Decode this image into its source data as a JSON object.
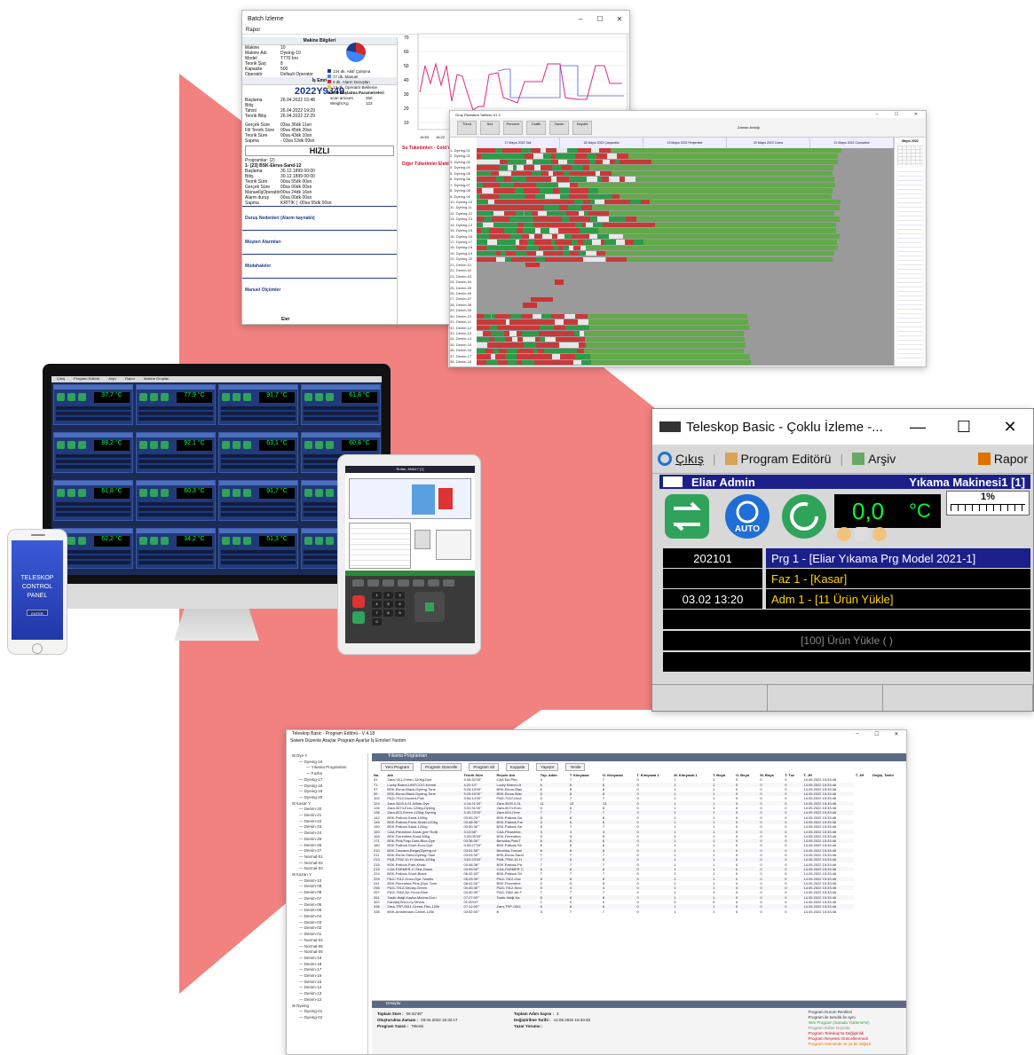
{
  "colors": {
    "accent_salmon": "#f2827f",
    "dark_navy": "#1b1f8a",
    "lcd_green": "#00ff33",
    "lcd_yellow": "#ffd400"
  },
  "batch_window": {
    "title": "Batch İzleme",
    "menu": "Rapor",
    "machine_header": "Makine Bilgileri",
    "machine_info": [
      {
        "k": "Makine",
        "v": "10"
      },
      {
        "k": "Makine Adı",
        "v": "Dyeing-10"
      },
      {
        "k": "Model",
        "v": "T770 bro"
      },
      {
        "k": "Teorik Şarj",
        "v": "8"
      },
      {
        "k": "Kapasite",
        "v": "500"
      },
      {
        "k": "Operatör",
        "v": "Default Operator"
      }
    ],
    "job_header": "İş Emri",
    "job_number": "2022Y9349",
    "job_info": [
      {
        "k": "Başlama",
        "v": "26.04.2022 15:48"
      },
      {
        "k": "Bitiş",
        "v": ""
      },
      {
        "k": "Tahsil",
        "v": "26.04.2022 19:29"
      },
      {
        "k": "Teorik Bitiş",
        "v": "26.04.2022 22:29"
      }
    ],
    "durations": [
      {
        "k": "Gerçek Süre",
        "v": "03sa 36dk 11sn"
      },
      {
        "k": "Fill Teorik Süre",
        "v": "00sa 45dk 20sn"
      },
      {
        "k": "Teorik Süre",
        "v": "00sa 43dk 10sn"
      },
      {
        "k": "Sapma",
        "v": "- 03sa 53dk 09sn"
      }
    ],
    "mode": "HIZLI",
    "programs_label": "Programlar: (2)",
    "program_name": "1- [23] BSK-Ekrus-Sand-12",
    "program_rows": [
      {
        "k": "Başlama",
        "v": "30.12.1899 00:00"
      },
      {
        "k": "Bitiş",
        "v": "30.12.1899 00:00"
      },
      {
        "k": "Teorik Süre",
        "v": "00sa 55dk 00sn"
      },
      {
        "k": "Gerçek Süre",
        "v": "00sa 00dk 00sn"
      },
      {
        "k": "ManuelİşOperatör",
        "v": "00sa 24dk 16sn"
      },
      {
        "k": "Alarm duruş",
        "v": "00sa 00dk 00sn"
      },
      {
        "k": "Sapma",
        "v": "KRİTİK ( -00sa 55dk 00sn"
      }
    ],
    "sections": [
      "Duruş Nedenleri (Alarm kaynaklı)",
      "Müşteri Alarmları",
      "Müdahaleler",
      "Manuel Olçümler"
    ],
    "legend": [
      "134 dk. Aktif Çalışma",
      "77 dk. Manuel",
      "0 dk. Alarm Duruşları",
      "13 dk. Operatör Bekleme"
    ],
    "param_header": "Batch Başlatma Parametreleri",
    "params": [
      {
        "k": "scan amount",
        "v": "260"
      },
      {
        "k": "Weight Kg",
        "v": "123"
      }
    ],
    "chart_ticks": [
      "70",
      "60",
      "50",
      "40",
      "30",
      "20",
      "10"
    ],
    "chart_time_ticks": [
      "15:53",
      "16:22",
      "16"
    ],
    "tab_labels": [
      "Su Tüketimleri - Cold W",
      "Diğer Tüketimler  Elektrik"
    ],
    "footer": "Eler"
  },
  "gantt_window": {
    "title": "Grup Planlama Tablosu V1.2",
    "tools": [
      "Tümü",
      "Seç",
      "Pencere",
      "Grafik",
      "Yazdır",
      "Kaydet"
    ],
    "period_label": "Zaman Aralığı",
    "date_headers": [
      "17 Mayıs 2022 Salı",
      "18 Mayıs 2022 Çarşamba",
      "19 Mayıs 2022 Perşembe",
      "20 Mayıs 2022 Cuma",
      "21 Mayıs 2022 Cumartesi"
    ],
    "calendar_title": "Mayıs 2022",
    "row_labels": [
      "1- Dyeing-01",
      "2- Dyeing-02",
      "3- Dyeing-03",
      "4- Dyeing-04",
      "5- Dyeing-05",
      "6- Dyeing-06",
      "7- Dyeing-07",
      "8- Dyeing-08",
      "9- Dyeing-09",
      "10- Dyeing-10",
      "11- Dyeing-11",
      "12- Dyeing-12",
      "13- Dyeing-13",
      "14- Dyeing-14",
      "15- Dyeing-15",
      "16- Dyeing-16",
      "17- Dyeing-17",
      "18- Dyeing-18",
      "19- Dyeing-19",
      "20- Dyeing-20",
      "21- Denim-01",
      "22- Denim-02",
      "23- Denim-03",
      "24- Denim-04",
      "25- Denim-05",
      "26- Denim-06",
      "27- Denim-07",
      "28- Denim-08",
      "29- Denim-09",
      "30- Denim-10",
      "31- Denim-11",
      "32- Denim-12",
      "33- Denim-13",
      "34- Denim-14",
      "35- Denim-15",
      "36- Denim-16",
      "37- Denim-17",
      "38- Denim-18"
    ]
  },
  "phone": {
    "line1": "TELESKOP",
    "line2": "CONTROL",
    "line3": "PANEL",
    "button": "ENTER"
  },
  "monitor": {
    "menu": [
      "Çıkış",
      "Program Editörü",
      "Arşiv",
      "Rapor",
      "Makine Grupları"
    ],
    "tiles": [
      {
        "value": "37,7 °C"
      },
      {
        "value": "77,9 °C"
      },
      {
        "value": "91,7 °C"
      },
      {
        "value": "61,8 °C"
      },
      {
        "value": "89,2 °C"
      },
      {
        "value": "92,1 °C"
      },
      {
        "value": "63,1 °C"
      },
      {
        "value": "60,8 °C"
      },
      {
        "value": "61,8 °C"
      },
      {
        "value": "60,3 °C"
      },
      {
        "value": "91,7 °C"
      },
      {
        "value": "81,1 °C"
      },
      {
        "value": "62,2 °C"
      },
      {
        "value": "34,2 °C"
      },
      {
        "value": "51,3 °C"
      },
      {
        "value": "79,8 °C"
      }
    ]
  },
  "tablet": {
    "title": "Rofan, ANA17 [1]",
    "keypad": [
      "1",
      "2",
      "3",
      "4",
      "5",
      "6",
      "7",
      "8",
      "9",
      "0"
    ]
  },
  "teleskop": {
    "title": "Teleskop Basic - Çoklu İzleme -...",
    "menu": {
      "exit": "Çıkış",
      "editor": "Program Editörü",
      "archive": "Arşiv",
      "report": "Rapor"
    },
    "user": "Eliar Admin",
    "machine": "Yıkama Makinesi1 [1]",
    "temperature": "0,0",
    "unit": "°C",
    "percent": "1%",
    "auto_label": "AUTO",
    "rows": [
      {
        "left": "202101",
        "right": "Prg 1 - [Eliar Yıkama Prg Model 2021-1]",
        "style": "blue"
      },
      {
        "left": "",
        "right": "Faz 1 - [Kasar]",
        "style": "black"
      },
      {
        "left": "03.02 13:20",
        "right": "Adm 1 - [11 Ürün Yükle]",
        "style": "black"
      }
    ],
    "status_text": "[100] Ürün Yükle (  )"
  },
  "editor": {
    "title": "Teleskop Basic - Program Editörü - V 4.18",
    "menu": "Sistem   Düzenle   Araçlar   Program   Ayarlar   İş Emirleri   Yardım",
    "caption": "Yıkama Programları",
    "buttons": [
      "Yeni Program",
      "Program Güncelle",
      "Program Sil",
      "Kopyala",
      "Yapıştır",
      "Yenile"
    ],
    "tree": [
      "Dye Y.",
      "Dyeing-16",
      "Yıkama Programları",
      "Fazlar",
      "Dyeing-17",
      "Dyeing-18",
      "Dyeing-19",
      "Dyeing-20",
      "Kasar Y.",
      "Denim-20",
      "Denim-21",
      "Denim-22",
      "Denim-23",
      "Denim-24",
      "Denim-25",
      "Denim-26",
      "Denim-27",
      "Normal-01",
      "Normal-02",
      "Normal-03",
      "Kazan Y.",
      "Denim-10",
      "Denim-09",
      "Denim-08",
      "Denim-07",
      "Denim-06",
      "Denim-05",
      "Denim-04",
      "Denim-03",
      "Denim-02",
      "Denim-01",
      "Normal-04",
      "Normal-05",
      "Normal-06",
      "Denim-19",
      "Denim-18",
      "Denim-17",
      "Denim-16",
      "Denim-15",
      "Denim-14",
      "Denim-13",
      "Denim-12",
      "Dyeing",
      "Dyeing-01",
      "Dyeing-02"
    ],
    "columns": [
      "No.",
      "Adı",
      "Teorik Süre",
      "Reçete Adı",
      "Top. Adım",
      "T. Kimyasal",
      "O. Kimyasal",
      "T. Kimyasal 1",
      "M. Kimyasal 1",
      "T. Boya",
      "O. Boya",
      "M. Boya",
      "T. Tuz",
      "T. JH",
      "T. JH",
      "Değiş. Tarihi"
    ],
    "rows": [
      [
        "51",
        "Zara-YA1-Green-120kg-Dye",
        "4:06:32'00\"",
        "C&A Ekr.Plev",
        "4",
        "7",
        "7",
        "0",
        "1",
        "1",
        "0",
        "0",
        "0",
        "14.05.2022 15:33:46"
      ],
      [
        "71",
        "Lucky Brand-UNITCOO-Kemal",
        "4:20:10'\"",
        "Lucky Brand-Ut",
        "6",
        "6",
        "6",
        "0",
        "1",
        "1",
        "0",
        "0",
        "0",
        "14.05.2022 15:33:46"
      ],
      [
        "97",
        "BSK-Ekrus-Black-Dyeing-Tone",
        "5:26:15'00\"",
        "BSK-Ekrus-Blac",
        "6",
        "8",
        "8",
        "0",
        "1",
        "1",
        "0",
        "0",
        "0",
        "14.05.2022 15:33:46"
      ],
      [
        "99",
        "BSK-Ekrus-Black-Dyeing-Tone",
        "5:25:15'00\"",
        "BSK-Ekrus-Blac",
        "6",
        "8",
        "8",
        "0",
        "1",
        "1",
        "0",
        "0",
        "0",
        "14.05.2022 15:33:46"
      ],
      [
        "102",
        "P&D-7912-Ducted-Pink",
        "3:54:14'00\"",
        "P&D-7912-Duct",
        "5",
        "7",
        "7",
        "0",
        "1",
        "1",
        "0",
        "0",
        "0",
        "14.05.2022 15:33:46"
      ],
      [
        "124",
        "Zara-3520.0.01-White-Dye",
        "4:14:21'00\"",
        "Zara-3520.0.01",
        "11",
        "13",
        "13",
        "0",
        "1",
        "1",
        "0",
        "0",
        "0",
        "14.05.2022 15:33:46"
      ],
      [
        "126",
        "Zara-0674-Ecru-120kg-Dyeing",
        "3:31:31'00\"",
        "Zara-0674-Ecru",
        "6",
        "6",
        "6",
        "0",
        "1",
        "1",
        "0",
        "0",
        "0",
        "14.05.2022 15:33:46"
      ],
      [
        "136",
        "Zara-603-Green-120kg-Dyeing",
        "3:32:23'00\"",
        "Zara-603-Gree",
        "7",
        "7",
        "7",
        "0",
        "1",
        "1",
        "0",
        "0",
        "0",
        "14.05.2022 15:33:46"
      ],
      [
        "142",
        "BSK-Pallock-Sand-100kg",
        "03:50:25'\"",
        "BSK-Pallock-Sa",
        "8",
        "8",
        "8",
        "0",
        "1",
        "1",
        "0",
        "0",
        "0",
        "14.05.2022 15:33:46"
      ],
      [
        "145",
        "BSK-Pallock-Farm-Khaki-120kg",
        "03:48:35'\"",
        "BSK-Pallock-Far",
        "6",
        "6",
        "6",
        "0",
        "1",
        "1",
        "0",
        "0",
        "0",
        "14.05.2022 15:33:46"
      ],
      [
        "150",
        "BSK-Pallock-Sand-120kg",
        "03:50:30'\"",
        "BSK-Pallock-Sa",
        "8",
        "7",
        "7",
        "0",
        "1",
        "1",
        "0",
        "0",
        "0",
        "14.05.2022 15:33:46"
      ],
      [
        "153",
        "C&A-Pleushine-Sand-(pm+Soft)",
        "3:12:58'\"",
        "C&A-Pleushine-",
        "3",
        "3",
        "3",
        "0",
        "1",
        "1",
        "0",
        "0",
        "0",
        "14.05.2022 15:33:46"
      ],
      [
        "168",
        "BSK-Florentina-Sand-60kg",
        "3:20:05'00\"",
        "BSK-Florentina",
        "5",
        "5",
        "5",
        "0",
        "1",
        "1",
        "0",
        "0",
        "0",
        "14.05.2022 15:33:46"
      ],
      [
        "171",
        "BSK-Pink/Trap-Dots-Blue-Dye",
        "03:36:06'\"",
        "Bershka-Pink/T",
        "6",
        "6",
        "6",
        "0",
        "1",
        "1",
        "0",
        "0",
        "0",
        "14.05.2022 15:33:46"
      ],
      [
        "180",
        "BSK-Pallock-Short-Ecru-Dye",
        "5:05:27'00\"",
        "BSK-Pallock-Sh",
        "6",
        "6",
        "6",
        "0",
        "1",
        "1",
        "0",
        "0",
        "0",
        "14.05.2022 15:33:46"
      ],
      [
        "210",
        "BSK-Toscana-Beige(Dyeing-ne",
        "03:51:55'\"",
        "Bershka-Toscan",
        "8",
        "8",
        "8",
        "0",
        "1",
        "1",
        "0",
        "0",
        "0",
        "14.05.2022 15:33:46"
      ],
      [
        "211",
        "BSK-Ekrus-Sand-Dyeing-Tone",
        "03:03:30'\"",
        "BSK-Ekrus-Sand",
        "7",
        "7",
        "7",
        "0",
        "1",
        "1",
        "0",
        "0",
        "0",
        "14.05.2022 15:33:46"
      ],
      [
        "213",
        "P&B-TRW-10-H-Vanilla-100kg",
        "3:02:23'00\"",
        "P&B-TRW-10-H",
        "7",
        "5",
        "5",
        "0",
        "1",
        "1",
        "0",
        "0",
        "0",
        "14.05.2022 15:33:46"
      ],
      [
        "215",
        "BSK-Pallock-Pam-Khaki",
        "03:48:36'\"",
        "BSK-Pallock-Pa",
        "7",
        "7",
        "7",
        "0",
        "1",
        "1",
        "0",
        "0",
        "0",
        "14.05.2022 15:33:46"
      ],
      [
        "216",
        "C&A-FARMER-C-Sea-Grass",
        "04:53:00'\"",
        "C&A-FARMER C",
        "6",
        "6",
        "6",
        "0",
        "1",
        "1",
        "0",
        "0",
        "0",
        "14.05.2022 15:33:46"
      ],
      [
        "224",
        "BSK-Pallock-Short-Black",
        "06:32:30'\"",
        "BSK-Pallock-Sh",
        "7",
        "7",
        "7",
        "0",
        "1",
        "1",
        "0",
        "0",
        "0",
        "14.05.2022 15:33:46"
      ],
      [
        "229",
        "P&G-7912-Onco-Dye-Tonello",
        "05:29:39'\"",
        "P&G-7912-Onc",
        "8",
        "8",
        "8",
        "0",
        "1",
        "1",
        "0",
        "0",
        "0",
        "14.05.2022 15:33:46"
      ],
      [
        "241",
        "BSK-Florentine-Pink-(Dye-Tone",
        "06:41:00'\"",
        "BSK-Florentine",
        "5",
        "5",
        "5",
        "0",
        "1",
        "1",
        "0",
        "0",
        "0",
        "14.05.2022 15:33:46"
      ],
      [
        "255",
        "P&G-7912-Smoky-Green",
        "04:40:30'\"",
        "P&G-7912-Smo",
        "5",
        "4",
        "4",
        "0",
        "1",
        "1",
        "0",
        "0",
        "0",
        "14.05.2022 15:33:46"
      ],
      [
        "257",
        "P&G-7562-Air-Force-Blue",
        "04:40:30'\"",
        "P&G-7562-Air F",
        "7",
        "7",
        "7",
        "0",
        "1",
        "1",
        "0",
        "0",
        "0",
        "14.05.2022 15:33:46"
      ],
      [
        "261",
        "Taslic-Walji-Kavka-Mocha-Ecru",
        "07:27:00'\"",
        "Taslic-Walji-Ka",
        "8",
        "8",
        "8",
        "0",
        "1",
        "1",
        "0",
        "0",
        "0",
        "14.05.2022 15:33:46"
      ],
      [
        "322",
        "Kanaat(Test-Ln)-Others",
        "01:00'00\"",
        "",
        "1",
        "0",
        "0",
        "0",
        "0",
        "0",
        "0",
        "0",
        "0",
        "14.05.2022 15:33:46"
      ],
      [
        "336",
        "Zara-TRP-0611-Green-Flex-120k",
        "07:12:00'\"",
        "Zara-TRP-0611",
        "6",
        "6",
        "6",
        "0",
        "1",
        "1",
        "0",
        "0",
        "0",
        "14.05.2022 15:33:46"
      ],
      [
        "338",
        "BSK-Amsterdam-Camel-120k",
        "03:52:00'\"",
        "B",
        "3",
        "7",
        "7",
        "0",
        "1",
        "1",
        "0",
        "0",
        "0",
        "14.05.2022 15:33:46"
      ]
    ],
    "details_caption": "Detaylar",
    "details": [
      {
        "k": "Toplam Süre :",
        "v": "06:32'45\""
      },
      {
        "k": "Toplam Adım Sayısı :",
        "v": "3"
      },
      {
        "k": "Oluşturulma Zamanı :",
        "v": "03.04.2022 16:32:17"
      },
      {
        "k": "Değiştirilme Tarihi :",
        "v": "14.05.2022 15:33:46"
      },
      {
        "k": "Program Yazarı :",
        "v": "Teknisi"
      },
      {
        "k": "Yazar Yorumu :",
        "v": ""
      }
    ],
    "status_legend": [
      {
        "text": "Program Durum Renkleri",
        "color": "#333333"
      },
      {
        "text": "Program ile tanıdık ile aynı",
        "color": "#333333"
      },
      {
        "text": "Yeni Program (Sarada Yükleme'te)",
        "color": "#2e9e3a"
      },
      {
        "text": "Program Editör Dışında",
        "color": "#888888"
      },
      {
        "text": "Program Teleskop'ta Değiştirildi",
        "color": "#c8102e"
      },
      {
        "text": "Program Reçetesi Güncellenmedi",
        "color": "#c8102e"
      },
      {
        "text": "Program İsteminde ve ya bir değişti",
        "color": "#e07000"
      }
    ]
  }
}
